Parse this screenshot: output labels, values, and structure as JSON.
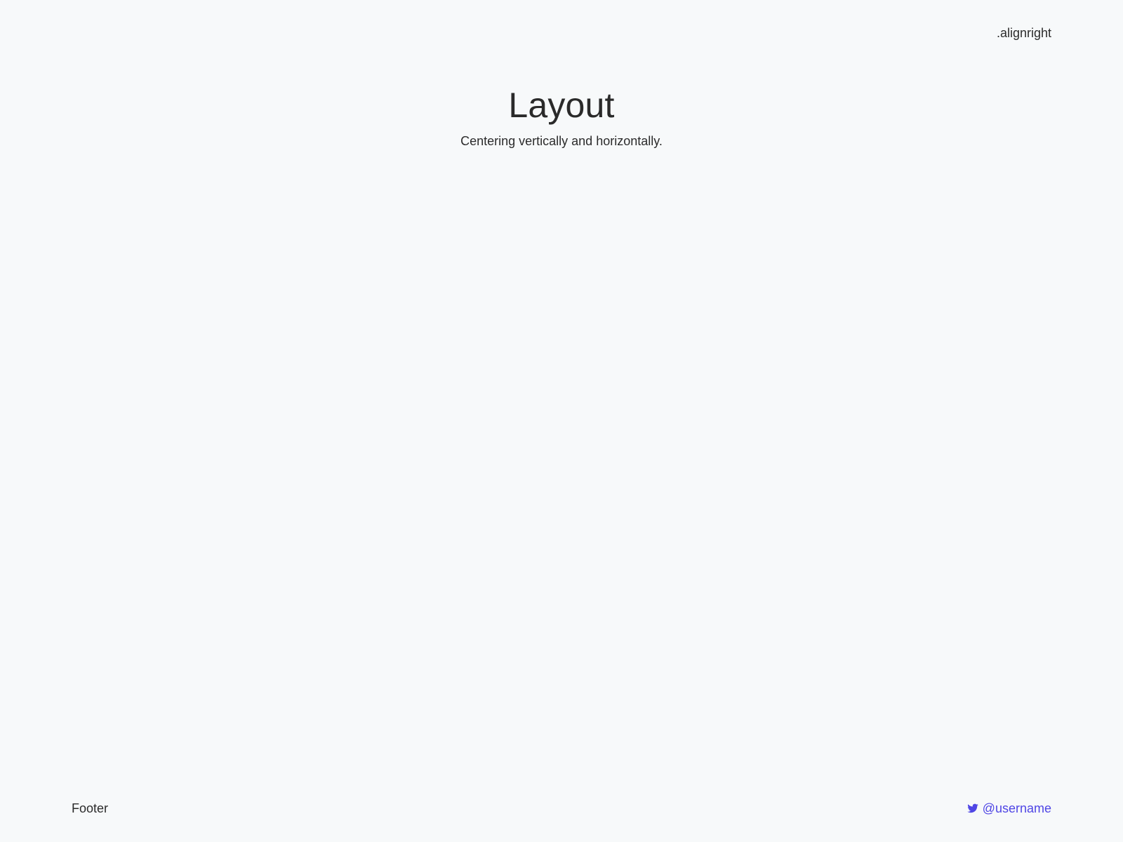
{
  "header": {
    "align_right_text": ".alignright"
  },
  "hero": {
    "title": "Layout",
    "subtitle": "Centering vertically and horizontally."
  },
  "footer": {
    "left_text": "Footer",
    "social": {
      "icon": "twitter-icon",
      "handle": "@username",
      "color": "#4f46e5"
    }
  },
  "colors": {
    "background": "#f7f9fa",
    "text": "#2b2b2b"
  }
}
